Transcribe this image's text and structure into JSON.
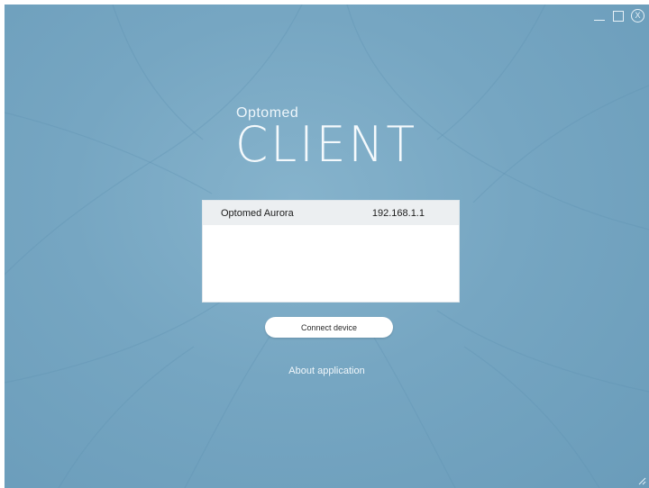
{
  "window": {
    "controls": {
      "minimize_icon": "minimize-icon",
      "maximize_icon": "maximize-icon",
      "close_label": "X"
    },
    "background_color": "#76a6c2"
  },
  "branding": {
    "company": "Optomed",
    "product": "CLIENT"
  },
  "devices": {
    "items": [
      {
        "name": "Optomed Aurora",
        "ip": "192.168.1.1"
      }
    ]
  },
  "actions": {
    "connect_label": "Connect device",
    "about_label": "About application"
  }
}
